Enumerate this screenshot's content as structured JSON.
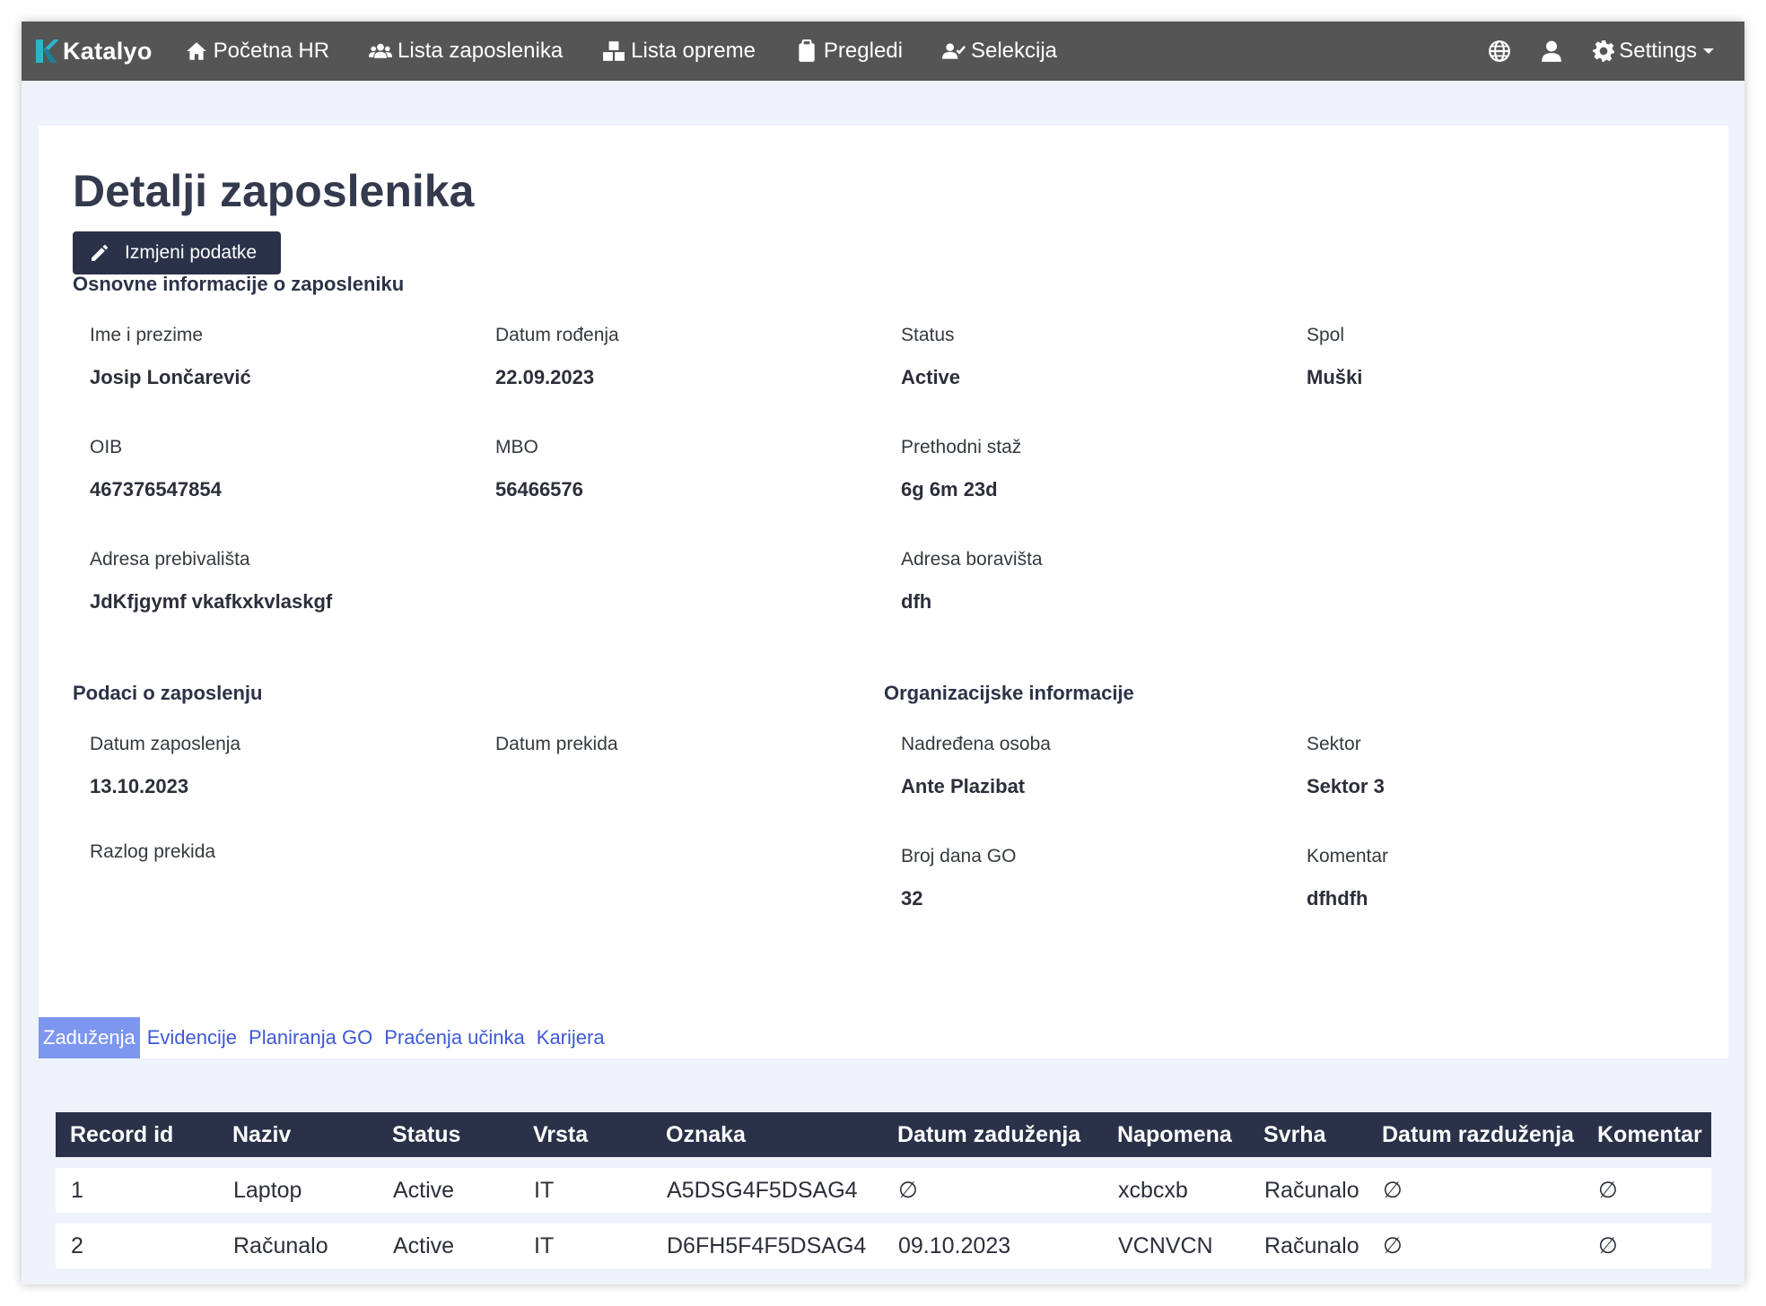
{
  "navbar": {
    "brand": "Katalyo",
    "items": [
      {
        "icon": "home-icon",
        "label": "Početna HR"
      },
      {
        "icon": "users-icon",
        "label": "Lista zaposlenika"
      },
      {
        "icon": "boxes-icon",
        "label": "Lista opreme"
      },
      {
        "icon": "clipboard-icon",
        "label": "Pregledi"
      },
      {
        "icon": "user-check-icon",
        "label": "Selekcija"
      }
    ],
    "right": {
      "globe_icon": "globe-icon",
      "user_icon": "user-icon",
      "settings_label": "Settings"
    }
  },
  "page": {
    "title": "Detalji zaposlenika",
    "edit_button": "Izmjeni podatke"
  },
  "basic_info": {
    "title": "Osnovne informacije o zaposleniku",
    "fields": [
      {
        "label": "Ime i prezime",
        "value": "Josip Lončarević"
      },
      {
        "label": "Datum rođenja",
        "value": "22.09.2023"
      },
      {
        "label": "Status",
        "value": "Active"
      },
      {
        "label": "Spol",
        "value": "Muški"
      },
      {
        "label": "OIB",
        "value": "467376547854"
      },
      {
        "label": "MBO",
        "value": "56466576"
      },
      {
        "label": "Prethodni staž",
        "value": "6g 6m 23d"
      },
      {
        "label": "Adresa prebivališta",
        "value": "JdKfjgymf vkafkxkvlaskgf"
      },
      {
        "label": "Adresa boravišta",
        "value": "dfh"
      }
    ]
  },
  "employment": {
    "title": "Podaci o zaposlenju",
    "fields": [
      {
        "label": "Datum zaposlenja",
        "value": "13.10.2023"
      },
      {
        "label": "Datum prekida",
        "value": ""
      },
      {
        "label": "Razlog prekida",
        "value": ""
      }
    ]
  },
  "organization": {
    "title": "Organizacijske informacije",
    "fields": [
      {
        "label": "Nadređena osoba",
        "value": "Ante Plazibat"
      },
      {
        "label": "Sektor",
        "value": "Sektor 3"
      },
      {
        "label": "Broj dana GO",
        "value": "32"
      },
      {
        "label": "Komentar",
        "value": "dfhdfh"
      }
    ]
  },
  "tabs": [
    "Zaduženja",
    "Evidencije",
    "Planiranja GO",
    "Praćenja učinka",
    "Karijera"
  ],
  "active_tab": "Zaduženja",
  "table": {
    "columns": [
      "Record id",
      "Naziv",
      "Status",
      "Vrsta",
      "Oznaka",
      "Datum zaduženja",
      "Napomena",
      "Svrha",
      "Datum razduženja",
      "Komentar"
    ],
    "rows": [
      [
        "1",
        "Laptop",
        "Active",
        "IT",
        "A5DSG4F5DSAG4",
        "∅",
        "xcbcxb",
        "Računalo",
        "∅",
        "∅"
      ],
      [
        "2",
        "Računalo",
        "Active",
        "IT",
        "D6FH5F4F5DSAG4",
        "09.10.2023",
        "VCNVCN",
        "Računalo",
        "∅",
        "∅"
      ]
    ]
  },
  "colors": {
    "navbar": "#555555",
    "primary_dark": "#2a3148",
    "tab_active": "#7d96f0",
    "link": "#3d59d6",
    "panel_bg": "#eef2fb"
  }
}
